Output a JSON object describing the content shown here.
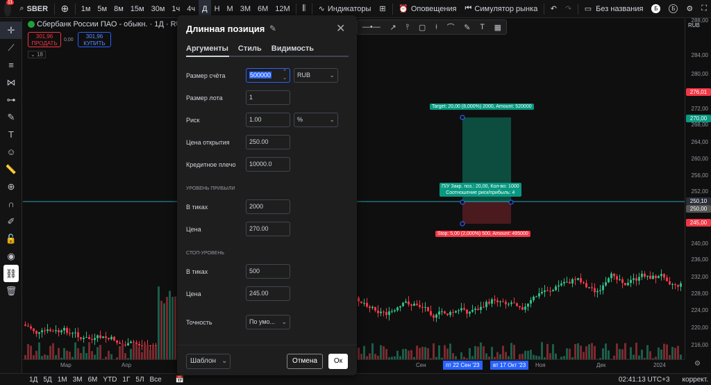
{
  "topbar": {
    "notif_count": "11",
    "symbol": "SBER",
    "intervals": [
      "1м",
      "5м",
      "8м",
      "15м",
      "30м",
      "1ч",
      "4ч",
      "Д",
      "Н",
      "М",
      "3М",
      "6М",
      "12М"
    ],
    "active_interval": "Д",
    "indicators": "Индикаторы",
    "alerts": "Оповещения",
    "replay": "Симулятор рынка",
    "layout_name": "Без названия",
    "b_letter": "Б"
  },
  "legend": {
    "title": "Сбербанк России ПАО - обыкн. · 1Д · RUS",
    "sell_price": "301,96",
    "sell_label": "ПРОДАТЬ",
    "spread": "0,00",
    "buy_price": "301,96",
    "buy_label": "КУПИТЬ",
    "collapse_count": "18"
  },
  "chart": {
    "currency": "RUB",
    "price_labels": [
      "288,00",
      "284,00",
      "280,00",
      "276,01",
      "272,00",
      "270,00",
      "268,00",
      "264,00",
      "260,00",
      "256,00",
      "252,00",
      "250,10",
      "250,00",
      "245,00",
      "240,00",
      "236,00",
      "232,00",
      "228,00",
      "224,00",
      "220,00",
      "216,00",
      "212,00"
    ],
    "target_label": "Target: 20,00 (8,000%) 2000, Amount: 520000",
    "pl_label_1": "П/У Закр. поз.: 20,00, Кол-во: 1000",
    "pl_label_2": "Соотношение риск/прибыль: 4",
    "stop_label": "Stop: 5,00 (2,000%) 500, Amount: 495000",
    "time_labels": [
      "Мар",
      "Апр",
      "Сен",
      "Ноя",
      "Дек",
      "2024"
    ],
    "time_tag_1": "пт 22 Сен '23",
    "time_tag_2": "вт 17 Окт '23",
    "colors": {
      "up": "#2ebd85",
      "down": "#f23645",
      "target_zone": "#0d4d3f",
      "stop_zone": "#4a1a1e"
    }
  },
  "bottombar": {
    "ranges": [
      "1Д",
      "5Д",
      "1М",
      "3М",
      "6М",
      "YTD",
      "1Г",
      "5Л",
      "Все"
    ],
    "clock": "02:41:13 UTC+3",
    "adjust": "коррект."
  },
  "dialog": {
    "title": "Длинная позиция",
    "tabs": [
      "Аргументы",
      "Стиль",
      "Видимость"
    ],
    "account_size_label": "Размер счёта",
    "account_size_value": "500000",
    "currency_value": "RUB",
    "lot_size_label": "Размер лота",
    "lot_size_value": "1",
    "risk_label": "Риск",
    "risk_value": "1.00",
    "risk_unit": "%",
    "entry_label": "Цена открытия",
    "entry_value": "250.00",
    "leverage_label": "Кредитное плечо",
    "leverage_value": "10000.0",
    "profit_section": "Уровень прибыли",
    "profit_ticks_label": "В тиках",
    "profit_ticks_value": "2000",
    "profit_price_label": "Цена",
    "profit_price_value": "270.00",
    "stop_section": "Стоп-уровень",
    "stop_ticks_label": "В тиках",
    "stop_ticks_value": "500",
    "stop_price_label": "Цена",
    "stop_price_value": "245.00",
    "precision_label": "Точность",
    "precision_value": "По умо...",
    "template_label": "Шаблон",
    "cancel_label": "Отмена",
    "ok_label": "Ок"
  }
}
